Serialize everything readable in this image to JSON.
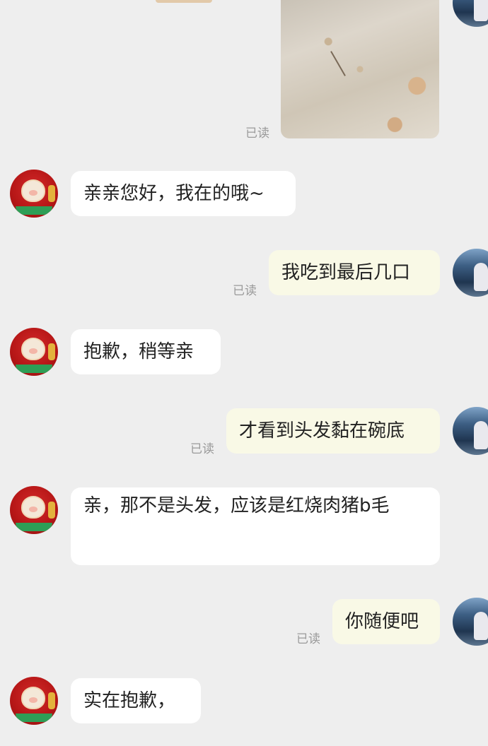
{
  "messages": {
    "m1": {
      "sender": "user",
      "type": "image",
      "status": "已读"
    },
    "m2": {
      "sender": "shop",
      "text": "亲亲您好，我在的哦~"
    },
    "m3": {
      "sender": "user",
      "text": "我吃到最后几口",
      "status": "已读"
    },
    "m4": {
      "sender": "shop",
      "text": "抱歉，稍等亲"
    },
    "m5": {
      "sender": "user",
      "text": "才看到头发黏在碗底",
      "status": "已读"
    },
    "m6": {
      "sender": "shop",
      "text": "亲，那不是头发，应该是红烧肉猪b毛"
    },
    "m7": {
      "sender": "user",
      "text": "你随便吧",
      "status": "已读"
    },
    "m8": {
      "sender": "shop",
      "text": "实在抱歉，"
    }
  },
  "colors": {
    "background": "#eeeeee",
    "incoming_bubble": "#ffffff",
    "outgoing_bubble": "#f9f9e6",
    "read_status": "#9a9a9a"
  },
  "icons": {
    "shop_avatar": "shop-avatar-icon",
    "user_avatar": "user-avatar-icon"
  }
}
